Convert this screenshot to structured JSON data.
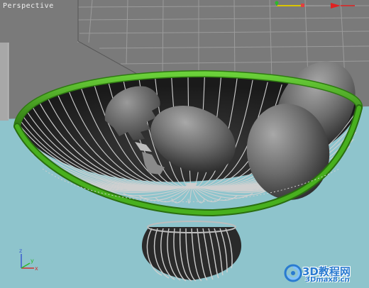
{
  "viewport": {
    "label": "Perspective",
    "background": "#7a7a7a",
    "floor_color": "#8ec4cc",
    "grid_color": "#9b9b9b"
  },
  "gizmo": {
    "axis_x": "x",
    "axis_y": "y",
    "axis_z": "z"
  },
  "scene_objects": [
    {
      "name": "wire-fruit-bowl",
      "rim_color": "#3f9b1b"
    },
    {
      "name": "egg",
      "count": 3
    },
    {
      "name": "cracked-eggshell"
    }
  ],
  "watermark": {
    "line1": "3D教程网",
    "line2": "3Dmax8.cn",
    "color": "#2a7bd0"
  }
}
